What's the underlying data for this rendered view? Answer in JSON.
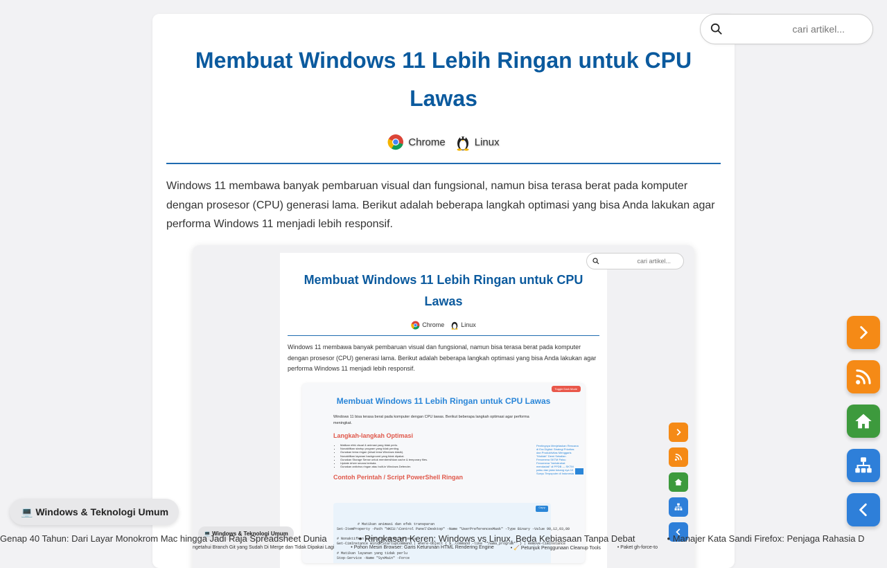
{
  "article": {
    "title": "Membuat Windows 11 Lebih Ringan untuk CPU Lawas",
    "tags": [
      "Chrome",
      "Linux"
    ],
    "intro": "Windows 11 membawa banyak pembaruan visual dan fungsional, namun bisa terasa berat pada komputer dengan prosesor (CPU) generasi lama. Berikut adalah beberapa langkah optimasi yang bisa Anda lakukan agar performa Windows 11 menjadi lebih responsif."
  },
  "embedded": {
    "title": "Membuat Windows 11 Lebih Ringan untuk CPU Lawas",
    "tags": [
      "Chrome",
      "Linux"
    ],
    "intro": "Windows 11 membawa banyak pembaruan visual dan fungsional, namun bisa terasa berat pada komputer dengan prosesor (CPU) generasi lama. Berikut adalah beberapa langkah optimasi yang bisa Anda lakukan agar performa Windows 11 menjadi lebih responsif.",
    "search_placeholder": "cari artikel...",
    "category": "💻 Windows & Teknologi Umum",
    "ticker": [
      "ngetahui Branch Git yang Sudah Di Merge dan Tidak Dipakai Lagi",
      "• Pohon Mesin Browser: Garis Keturunan HTML Rendering Engine",
      "• 🧹 Petunjuk Penggunaan Cleanup Tools",
      "• Paket gh-force-to"
    ],
    "nested": {
      "toggle": "Toggle Dark Mode",
      "title": "Membuat Windows 11 Lebih Ringan untuk CPU Lawas",
      "intro": "Windows 11 bisa terasa berat pada komputer dengan CPU lawas. Berikut beberapa langkah optimasi agar performa meningkat.",
      "heading_steps": "Langkah-langkah Optimasi",
      "steps": [
        "Matikan efek visual & animasi yang tidak perlu.",
        "Nonaktifkan startup program yang tidak penting.",
        "Gunakan tema ringan (misal tema Windows klasik).",
        "Nonaktifkan layanan background yang tidak dipakai.",
        "Gunakan Storage Sense untuk membersihkan cache & temporary files.",
        "Update driver secara berkala.",
        "Gunakan antivirus ringan atau built-in Windows Defender."
      ],
      "heading_script": "Contoh Perintah / Script PowerShell Ringan",
      "copy_label": "Copy",
      "code": "# Matikan animasi dan efek transparan\nSet-ItemProperty -Path \"HKCU:\\Control Panel\\Desktop\" -Name \"UserPreferencesMask\" -Type Binary -Value 90,12,03,80\n\n# Nonaktifkan startup program tertentu\nGet-CimInstance Win32_StartupCommand | Where-Object { $_.Command -like \"*nama_program*\" } | Remove-CimInstance\n\n# Matikan layanan yang tidak perlu\nStop-Service -Name \"SysMain\" -Force",
      "side_links": "Pentingnya Menjelaskan Rencana di Era Digital: Strategi Prioritas dan Produktivitas Menggaris \"Moklah\" Demi Sekalian Fenomena SKTM Palsu Fenomena \"beristirahat mendadak\" di PPDB — SKTM palsu dan jalan tukang nya 10 Sunyu Terpopuler di Indonesia"
    }
  },
  "search": {
    "placeholder": "cari artikel..."
  },
  "category": {
    "label": "💻 Windows & Teknologi Umum"
  },
  "ticker": [
    "Genap 40 Tahun: Dari Layar Monokrom Mac hingga Jadi Raja Spreadsheet Dunia",
    "• Ringkasan Keren: Windows vs Linux, Beda Kebiasaan Tanpa Debat",
    "• Manajer Kata Sandi Firefox: Penjaga Rahasia D"
  ],
  "fabs": [
    {
      "icon": "chevron-right-icon",
      "color": "#f58a16"
    },
    {
      "icon": "rss-icon",
      "color": "#f58a16"
    },
    {
      "icon": "home-icon",
      "color": "#3d9a3d"
    },
    {
      "icon": "sitemap-icon",
      "color": "#2e7fd9"
    },
    {
      "icon": "chevron-left-icon",
      "color": "#2e7fd9"
    }
  ]
}
